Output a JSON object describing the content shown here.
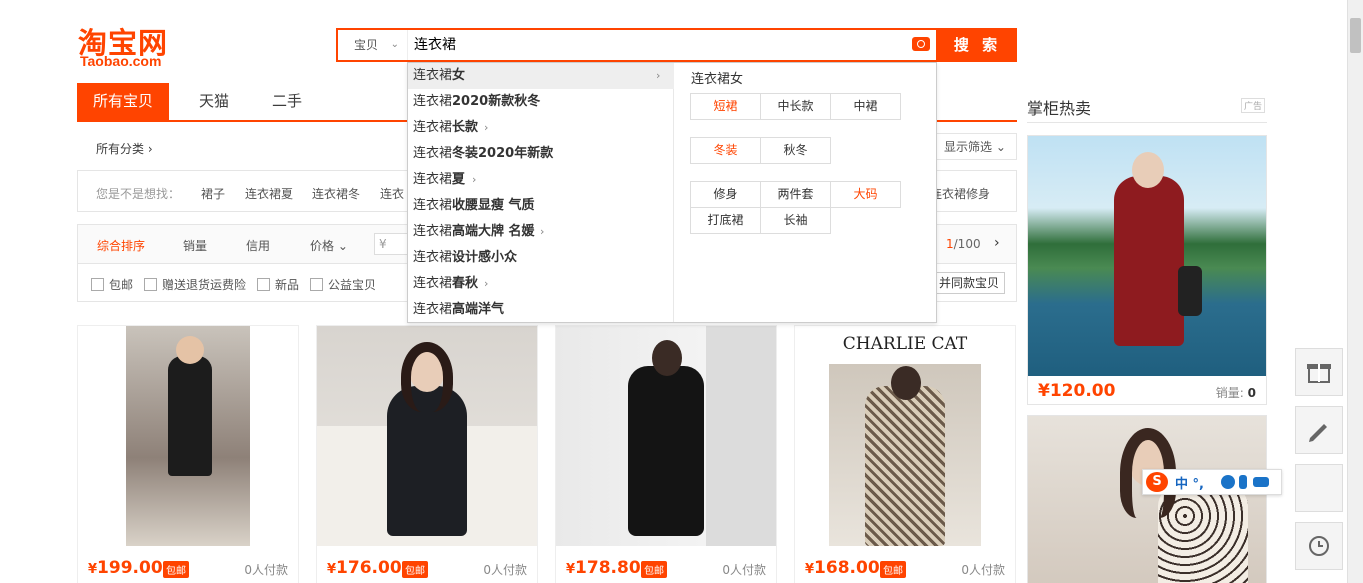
{
  "header": {
    "logo_cn": "淘宝网",
    "logo_en": "Taobao.com",
    "search_type": "宝贝",
    "search_query": "连衣裙",
    "search_button": "搜 索"
  },
  "tabs": [
    "所有宝贝",
    "天猫",
    "二手"
  ],
  "crumb": "所有分类 ›",
  "show_filter": "显示筛选",
  "suggest": {
    "label": "您是不是想找：",
    "items": [
      "裙子",
      "连衣裙夏",
      "连衣裙冬",
      "连衣",
      "连衣裙修身"
    ]
  },
  "sort": {
    "items": [
      "综合排序",
      "销量",
      "信用",
      "价格"
    ],
    "price_symbol": "¥",
    "page_current": "1",
    "page_total": "/100"
  },
  "filters": [
    "包邮",
    "赠送退货运费险",
    "新品",
    "公益宝贝"
  ],
  "same_button": "并同款宝贝",
  "dropdown": {
    "items": [
      {
        "prefix": "连衣裙",
        "suffix": "女",
        "chev": true
      },
      {
        "prefix": "连衣裙",
        "suffix": "2020新款秋冬",
        "chev": false
      },
      {
        "prefix": "连衣裙",
        "suffix": "长款",
        "chev": true
      },
      {
        "prefix": "连衣裙",
        "suffix": "冬装2020年新款",
        "chev": false
      },
      {
        "prefix": "连衣裙",
        "suffix": "夏",
        "chev": true
      },
      {
        "prefix": "连衣裙",
        "suffix": "收腰显瘦 气质",
        "chev": false
      },
      {
        "prefix": "连衣裙",
        "suffix": "高端大牌 名媛",
        "chev": true
      },
      {
        "prefix": "连衣裙",
        "suffix": "设计感小众",
        "chev": false
      },
      {
        "prefix": "连衣裙",
        "suffix": "春秋",
        "chev": true
      },
      {
        "prefix": "连衣裙",
        "suffix": "高端洋气",
        "chev": false
      }
    ],
    "right_title": "连衣裙女",
    "chips_row1": [
      "短裙",
      "中长款",
      "中裙"
    ],
    "chips_row2": [
      "冬装",
      "秋冬"
    ],
    "chips_row3": [
      "修身",
      "两件套",
      "大码"
    ],
    "chips_row4": [
      "打底裙",
      "长袖"
    ]
  },
  "products": [
    {
      "price": "199.00",
      "tag": "包邮",
      "paid": "0人付款"
    },
    {
      "price": "176.00",
      "tag": "包邮",
      "paid": "0人付款"
    },
    {
      "price": "178.80",
      "tag": "包邮",
      "paid": "0人付款"
    },
    {
      "price": "168.00",
      "tag": "包邮",
      "paid": "0人付款",
      "brand": "CHARLIE CAT"
    }
  ],
  "side": {
    "title": "掌柜热卖",
    "ad": "广告",
    "item1_price": "120.00",
    "sales_label": "销量:",
    "sales_value": "0"
  },
  "currency": "¥",
  "ime": {
    "logo": "S",
    "lang": "中 °,"
  },
  "colors": {
    "accent": "#ff4400",
    "border": "#e5e5e5"
  }
}
